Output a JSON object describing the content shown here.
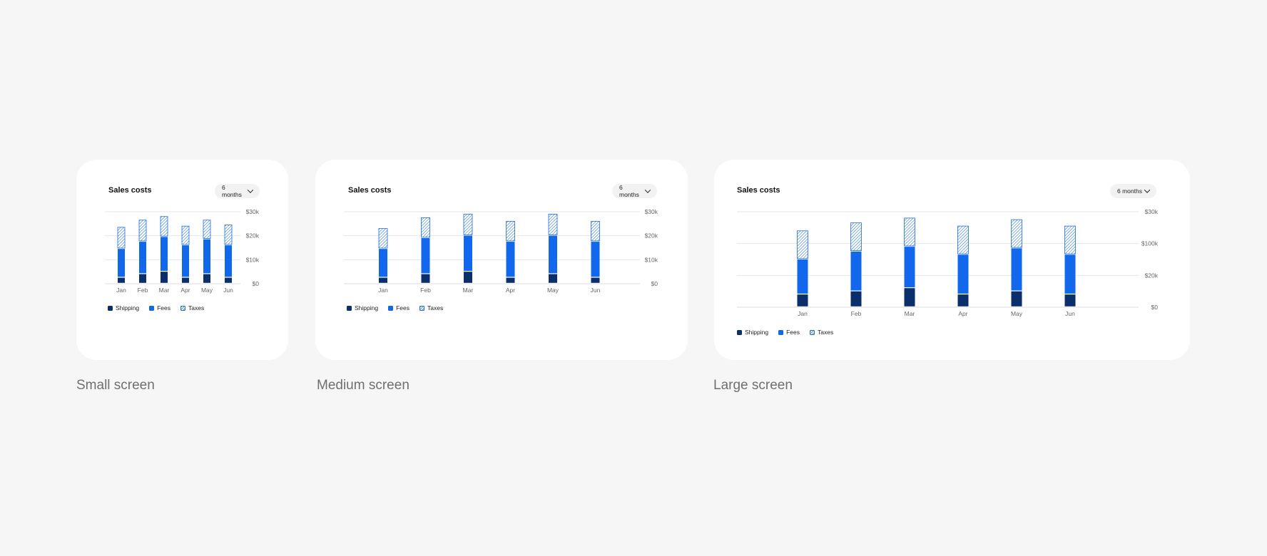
{
  "colors": {
    "shipping": "#0b2f6b",
    "fees": "#1168ec",
    "taxes": "#1f6fd1",
    "grid": "#e6e6e6",
    "tick": "#666666"
  },
  "legend": {
    "shipping": "Shipping",
    "fees": "Fees",
    "taxes": "Taxes"
  },
  "panels": {
    "small": {
      "title": "Sales costs",
      "range_label": "6 months",
      "caption": "Small screen"
    },
    "medium": {
      "title": "Sales costs",
      "range_label": "6 months",
      "caption": "Medium screen"
    },
    "large": {
      "title": "Sales costs",
      "range_label": "6 months",
      "caption": "Large screen"
    }
  },
  "chart_data": [
    {
      "type": "bar",
      "stacked": true,
      "title": "Sales costs",
      "categories": [
        "Jan",
        "Feb",
        "Mar",
        "Apr",
        "May",
        "Jun"
      ],
      "series": [
        {
          "name": "Shipping",
          "values": [
            2.5,
            4,
            5,
            2.5,
            4,
            2.5
          ]
        },
        {
          "name": "Fees",
          "values": [
            12,
            13.5,
            14.5,
            13.5,
            14.5,
            13.5
          ]
        },
        {
          "name": "Taxes",
          "values": [
            9,
            9,
            8.5,
            8,
            8,
            8.5
          ]
        }
      ],
      "ylim": [
        0,
        30
      ],
      "yticks": [
        0,
        10,
        20,
        30
      ],
      "ytick_labels": [
        "$0",
        "$10k",
        "$20k",
        "$30k"
      ],
      "grid": true,
      "legend_position": "bottom-left"
    },
    {
      "type": "bar",
      "stacked": true,
      "title": "Sales costs",
      "categories": [
        "Jan",
        "Feb",
        "Mar",
        "Apr",
        "May",
        "Jun"
      ],
      "series": [
        {
          "name": "Shipping",
          "values": [
            2.5,
            4,
            5,
            2.5,
            4,
            2.5
          ]
        },
        {
          "name": "Fees",
          "values": [
            12,
            15,
            15,
            15,
            16,
            15
          ]
        },
        {
          "name": "Taxes",
          "values": [
            8.5,
            8.5,
            9,
            8.5,
            9,
            8.5
          ]
        }
      ],
      "ylim": [
        0,
        30
      ],
      "yticks": [
        0,
        10,
        20,
        30
      ],
      "ytick_labels": [
        "$0",
        "$10k",
        "$20k",
        "$30k"
      ],
      "grid": true,
      "legend_position": "bottom-left"
    },
    {
      "type": "bar",
      "stacked": true,
      "title": "Sales costs",
      "categories": [
        "Jan",
        "Feb",
        "Mar",
        "Apr",
        "May",
        "Jun"
      ],
      "series": [
        {
          "name": "Shipping",
          "values": [
            4,
            5,
            6,
            4,
            5,
            4
          ]
        },
        {
          "name": "Fees",
          "values": [
            11,
            12.5,
            13,
            12.5,
            13.5,
            12.5
          ]
        },
        {
          "name": "Taxes",
          "values": [
            9,
            9,
            9,
            9,
            9,
            9
          ]
        }
      ],
      "ylim": [
        0,
        30
      ],
      "yticks": [
        0,
        10,
        20,
        30
      ],
      "ytick_labels": [
        "$0",
        "$20k",
        "$100k",
        "$30k"
      ],
      "grid": true,
      "legend_position": "bottom-left"
    }
  ]
}
